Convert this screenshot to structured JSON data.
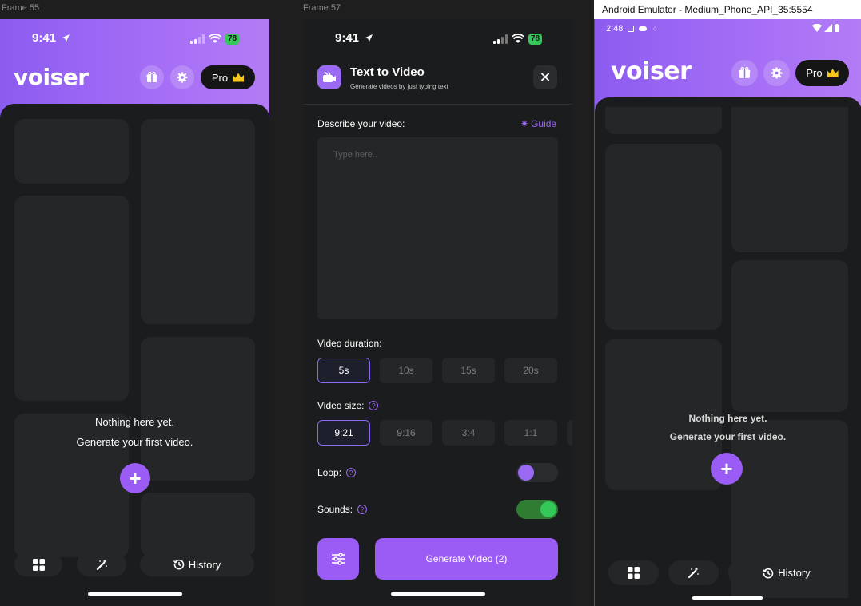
{
  "frames": {
    "frame1_label": "Frame 55",
    "frame2_label": "Frame 57",
    "emulator_title": "Android Emulator - Medium_Phone_API_35:5554"
  },
  "ios_status": {
    "time": "9:41",
    "battery": "78"
  },
  "android_status": {
    "time": "2:48"
  },
  "home": {
    "logo": "voiser",
    "pro_label": "Pro",
    "empty_line1": "Nothing here yet.",
    "empty_line2": "Generate your first video.",
    "plus_symbol": "+",
    "nav": {
      "history_label": "History"
    }
  },
  "text_to_video": {
    "title": "Text to Video",
    "subtitle": "Generate videos by just typing text",
    "describe_label": "Describe your video:",
    "guide_label": "Guide",
    "placeholder": "Type here..",
    "duration_label": "Video duration:",
    "durations": [
      "5s",
      "10s",
      "15s",
      "20s"
    ],
    "selected_duration": "5s",
    "size_label": "Video size:",
    "sizes": [
      "9:21",
      "9:16",
      "3:4",
      "1:1"
    ],
    "selected_size": "9:21",
    "loop_label": "Loop:",
    "loop_enabled": false,
    "sounds_label": "Sounds:",
    "sounds_enabled": true,
    "generate_label": "Generate Video (2)",
    "help_symbol": "?",
    "close_symbol": "✕"
  },
  "colors": {
    "accent": "#9b5cf5",
    "background": "#1b1c1d",
    "tile": "#242628",
    "toggle_on": "#34c759"
  }
}
